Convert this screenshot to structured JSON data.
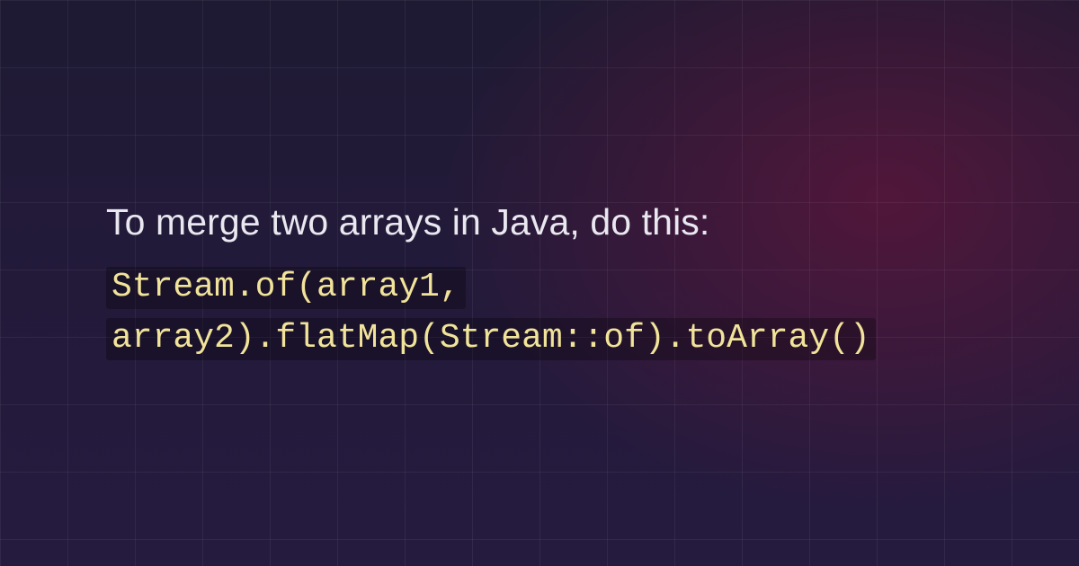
{
  "lead_text": "To merge two arrays in Java, do this:",
  "code_text": "Stream.of(array1, array2).flatMap(Stream::of).toArray()",
  "colors": {
    "text": "#e9e7ef",
    "code_text": "#f1e39a",
    "code_bg": "rgba(0,0,0,0.28)"
  }
}
